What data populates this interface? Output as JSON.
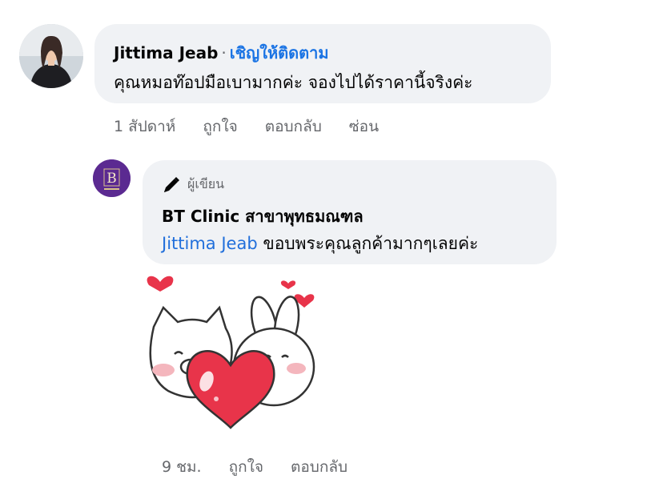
{
  "comment1": {
    "author": "Jittima Jeab",
    "separator": "·",
    "follow_label": "เชิญให้ติดตาม",
    "text": "คุณหมอท๊อปมือเบามากค่ะ จองไปได้ราคานี้จริงค่ะ",
    "actions": {
      "time": "1 สัปดาห์",
      "like": "ถูกใจ",
      "reply": "ตอบกลับ",
      "hide": "ซ่อน"
    }
  },
  "reply1": {
    "author_badge_label": "ผู้เขียน",
    "author": "BT Clinic สาขาพุทธมณฑล",
    "mention": "Jittima Jeab",
    "text": "ขอบพระคุณลูกค้ามากๆเลยค่ะ",
    "avatar_letter": "B",
    "sticker_icon": "cat-bunny-heart-sticker",
    "actions": {
      "time": "9 ชม.",
      "like": "ถูกใจ",
      "reply": "ตอบกลับ"
    }
  },
  "colors": {
    "bubble": "#f0f2f5",
    "link": "#1b74e4",
    "muted": "#65676b",
    "clinic_purple": "#5b2a91",
    "heart_red": "#e8344a"
  }
}
